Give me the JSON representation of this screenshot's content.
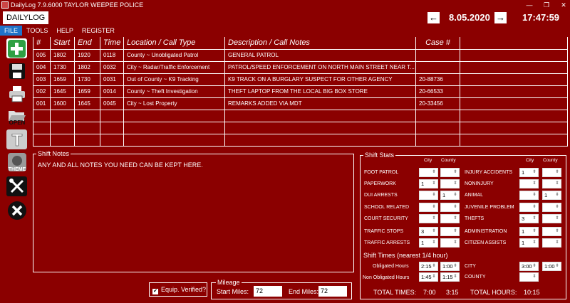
{
  "window": {
    "title": "DailyLog 7.9.6000  TAYLOR  WEEPEE POLICE"
  },
  "header": {
    "program_title": "DAILYLOG",
    "date": "8.05.2020",
    "time": "17:47:59",
    "prev_glyph": "←",
    "next_glyph": "→"
  },
  "menu": [
    "FILE",
    "TOOLS",
    "HELP",
    "REGISTER"
  ],
  "toolbar": {
    "add": "",
    "save": "",
    "print": "",
    "open": "OPEN",
    "text": "T",
    "theme": "THEME",
    "tools": "",
    "close": ""
  },
  "log": {
    "columns": [
      "#",
      "Start",
      "End",
      "Time",
      "Location / Call Type",
      "Description / Call Notes",
      "Case #",
      ""
    ],
    "rows": [
      [
        "005",
        "1802",
        "1920",
        "0118",
        "County ~ Unobligated Patrol",
        "GENERAL PATROL",
        "",
        ""
      ],
      [
        "004",
        "1730",
        "1802",
        "0032",
        "City ~ Radar/Traffic Enforcement",
        "PATROL/SPEED ENFORCEMENT ON NORTH MAIN STREET NEAR T...",
        "",
        ""
      ],
      [
        "003",
        "1659",
        "1730",
        "0031",
        "Out of County ~ K9 Tracking",
        "K9 TRACK ON A BURGLARY SUSPECT FOR OTHER AGENCY",
        "20-88736",
        ""
      ],
      [
        "002",
        "1645",
        "1659",
        "0014",
        "County ~ Theft Investigation",
        "THEFT LAPTOP FROM THE LOCAL BIG BOX STORE",
        "20-66533",
        ""
      ],
      [
        "001",
        "1600",
        "1645",
        "0045",
        "City ~ Lost Property",
        "REMARKS ADDED VIA MDT",
        "20-33456",
        ""
      ],
      [
        "",
        "",
        "",
        "",
        "",
        "",
        "",
        ""
      ],
      [
        "",
        "",
        "",
        "",
        "",
        "",
        "",
        ""
      ],
      [
        "",
        "",
        "",
        "",
        "",
        "",
        "",
        ""
      ]
    ]
  },
  "notes": {
    "legend": "Shift Notes",
    "text": "ANY AND ALL NOTES YOU NEED CAN BE KEPT HERE."
  },
  "stats": {
    "legend": "Shift Stats",
    "col_city": "City",
    "col_county": "County",
    "left": [
      {
        "label": "FOOT PATROL",
        "city": "",
        "county": ""
      },
      {
        "label": "PAPERWORK",
        "city": "1",
        "county": ""
      },
      {
        "label": "DUI ARRESTS",
        "city": "",
        "county": "1"
      },
      {
        "label": "SCHOOL RELATED",
        "city": "",
        "county": ""
      },
      {
        "label": "COURT SECURITY",
        "city": "",
        "county": ""
      },
      {
        "label": "TRAFFIC STOPS",
        "city": "3",
        "county": ""
      },
      {
        "label": "TRAFFIC ARRESTS",
        "city": "1",
        "county": ""
      }
    ],
    "right": [
      {
        "label": "INJURY ACCIDENTS",
        "city": "1",
        "county": ""
      },
      {
        "label": "NONINJURY",
        "city": "",
        "county": ""
      },
      {
        "label": "ANIMAL",
        "city": "",
        "county": "1"
      },
      {
        "label": "JUVENILE PROBLEM",
        "city": "",
        "county": ""
      },
      {
        "label": "THEFTS",
        "city": "3",
        "county": ""
      },
      {
        "label": "ADMINISTRATION",
        "city": "1",
        "county": ""
      },
      {
        "label": "CITIZEN ASSISTS",
        "city": "1",
        "county": ""
      }
    ],
    "shift_times_title": "Shift Times (nearest 1/4 hour)",
    "obligated_label": "Obligated Hours",
    "obligated_city": "2:15",
    "obligated_county": "1:00",
    "non_obligated_label": "Non Obligated Hours",
    "non_obligated_city": "1:45",
    "non_obligated_county": "1:15",
    "city_label": "CITY",
    "city_a": "3:00",
    "city_b": "1:00",
    "county_label": "COUNTY",
    "county_a": "",
    "total_times_label": "TOTAL TIMES:",
    "total_times_city": "7:00",
    "total_times_county": "3:15",
    "total_hours_label": "TOTAL HOURS:",
    "total_hours": "10:15"
  },
  "equip": {
    "label": "Equip. Verified?",
    "checked": "✔"
  },
  "mileage": {
    "legend": "Mileage",
    "start_label": "Start Miles:",
    "start_value": "72",
    "end_label": "End Miles:",
    "end_value": "72"
  },
  "colors": {
    "background": "#8b0000",
    "menu_active": "#1f73c9",
    "add_green": "#2fa043"
  }
}
